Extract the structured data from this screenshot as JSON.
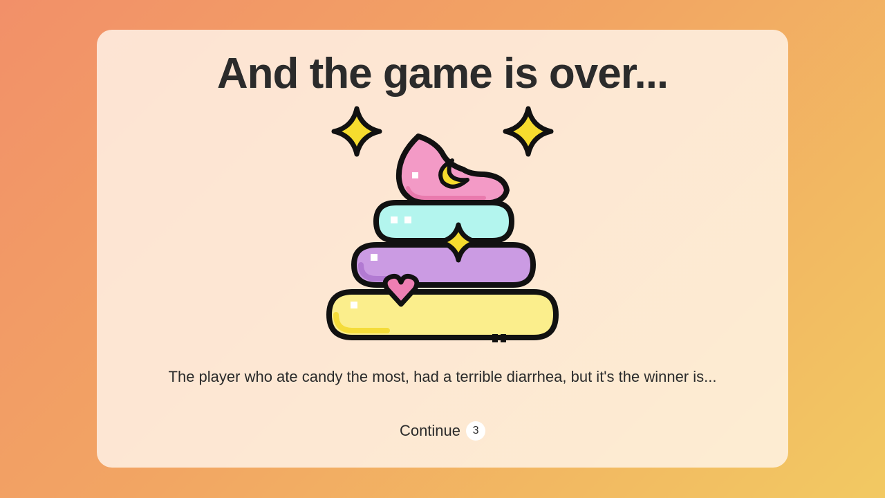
{
  "screen": {
    "title": "And the game is over...",
    "message": "The player who ate candy the most, had a terrible diarrhea, but it's the winner is...",
    "illustration_icon": "rainbow-poop-with-sparkles-icon"
  },
  "continue_button": {
    "label": "Continue",
    "countdown": "3"
  },
  "colors": {
    "background_start": "#f29069",
    "background_end": "#f2c962",
    "pink": "#f39ac6",
    "cyan": "#b3f5ee",
    "purple": "#cb9be3",
    "yellow": "#fbee8c",
    "star": "#f6dc2e",
    "outline": "#111111"
  }
}
